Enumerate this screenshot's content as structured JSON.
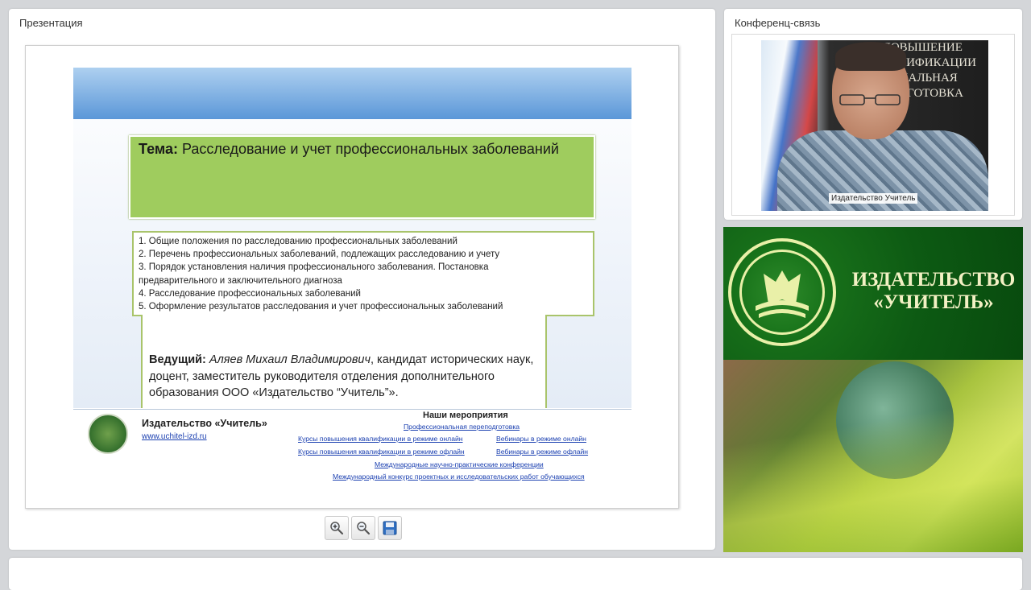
{
  "presentation": {
    "panel_title": "Презентация",
    "slide": {
      "topic_label": "Тема:",
      "topic_text": " Расследование и учет профессиональных заболеваний",
      "agenda": [
        "1. Общие положения по расследованию профессиональных заболеваний",
        "2. Перечень профессиональных заболеваний, подлежащих расследованию и учету",
        "3. Порядок установления наличия профессионального заболевания. Постановка",
        "предварительного и заключительного диагноза",
        "4. Расследование профессиональных заболеваний",
        "5. Оформление результатов расследования и учет профессиональных заболеваний"
      ],
      "host_label": "Ведущий:",
      "host_name": "Аляев Михаил Владимирович",
      "host_desc": ", кандидат исторических наук, доцент, заместитель руководителя отделения дополнительного образования ООО «Издательство “Учитель”».",
      "footer": {
        "brand": "Издательство «Учитель»",
        "site": "www.uchitel-izd.ru",
        "events_title": "Наши мероприятия",
        "events": [
          "Профессиональная переподготовка",
          "Курсы повышения квалификации в режиме онлайн",
          "Вебинары в режиме онлайн",
          "Курсы повышения квалификации в режиме офлайн",
          "Вебинары в режиме офлайн",
          "Международные научно-практические конференции",
          "Международный конкурс проектных и исследовательских работ обучающихся"
        ]
      }
    },
    "toolbar": {
      "zoom_in_icon": "zoom-in-icon",
      "zoom_out_icon": "zoom-out-icon",
      "save_icon": "save-icon"
    }
  },
  "conference": {
    "panel_title": "Конференц-связь",
    "participant_name": "Издательство Учитель",
    "poster_lines": [
      "ПОВЫШЕНИЕ",
      "ВАЛИФИКАЦИИ",
      "ИОНАЛЬНАЯ",
      "ПОДГОТОВКА"
    ]
  },
  "ad": {
    "brand_line1": "ИЗДАТЕЛЬСТВО",
    "brand_line2": "«УЧИТЕЛЬ»"
  },
  "colors": {
    "topic_green": "#9fcc5e",
    "link_blue": "#1a3fb0",
    "ad_green": "#0d5a13"
  }
}
